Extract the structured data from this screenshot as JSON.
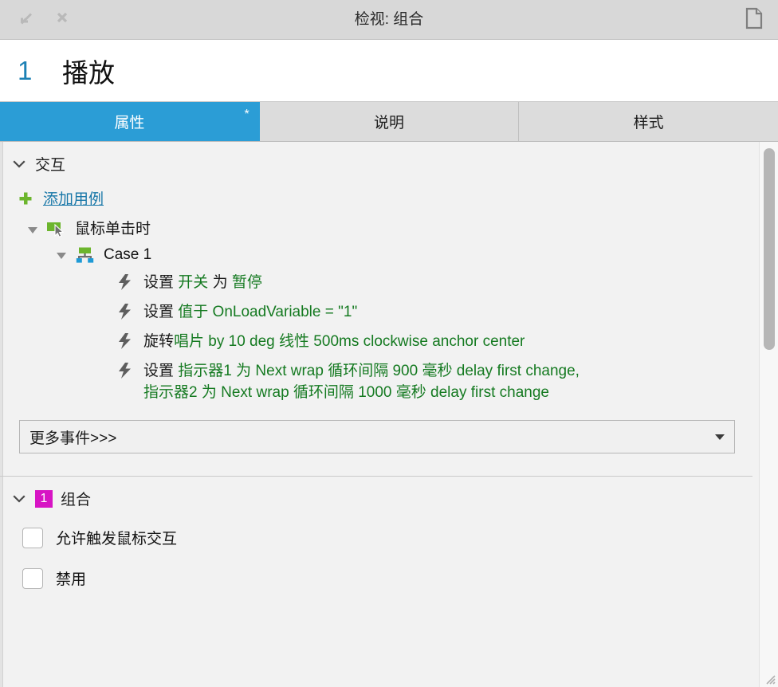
{
  "titlebar": {
    "title": "检视: 组合",
    "restore_icon": "minimize-restore-icon",
    "close_icon": "close-icon",
    "page_icon": "page-icon"
  },
  "object_header": {
    "number": "1",
    "name": "播放"
  },
  "tabs": [
    {
      "label": "属性",
      "active": true,
      "modified_marker": "*"
    },
    {
      "label": "说明",
      "active": false,
      "modified_marker": ""
    },
    {
      "label": "样式",
      "active": false,
      "modified_marker": ""
    }
  ],
  "interactions": {
    "section_title": "交互",
    "add_case_label": "添加用例",
    "event": {
      "label": "鼠标单击时",
      "icon": "mouse-click-icon"
    },
    "case": {
      "label": "Case 1",
      "icon": "case-branch-icon"
    },
    "actions": [
      {
        "icon": "lightning-bolt-icon",
        "lines": [
          [
            {
              "text": "设置 ",
              "kind": "verb"
            },
            {
              "text": "开关 ",
              "kind": "arg"
            },
            {
              "text": "为 ",
              "kind": "verb"
            },
            {
              "text": "暂停",
              "kind": "arg"
            }
          ]
        ]
      },
      {
        "icon": "lightning-bolt-icon",
        "lines": [
          [
            {
              "text": "设置 ",
              "kind": "verb"
            },
            {
              "text": "值于 OnLoadVariable = \"1\"",
              "kind": "arg"
            }
          ]
        ]
      },
      {
        "icon": "lightning-bolt-icon",
        "lines": [
          [
            {
              "text": "旋转",
              "kind": "verb"
            },
            {
              "text": "唱片 by 10 deg 线性 500ms clockwise anchor center",
              "kind": "arg"
            }
          ]
        ]
      },
      {
        "icon": "lightning-bolt-icon",
        "lines": [
          [
            {
              "text": "设置 ",
              "kind": "verb"
            },
            {
              "text": "指示器1 为 Next wrap 循环间隔 900 毫秒 delay first change,",
              "kind": "arg"
            }
          ],
          [
            {
              "text": "指示器2 为 Next wrap 循环间隔 1000 毫秒 delay first change",
              "kind": "arg"
            }
          ]
        ]
      }
    ],
    "more_events": {
      "label": "更多事件>>>",
      "arrow_icon": "chevron-down-icon"
    }
  },
  "group_section": {
    "badge": "1",
    "title": "组合",
    "checkboxes": [
      {
        "label": "允许触发鼠标交互",
        "checked": false
      },
      {
        "label": "禁用",
        "checked": false
      }
    ]
  },
  "colors": {
    "accent_blue": "#2b9dd6",
    "link_blue": "#1877a8",
    "header_number_blue": "#1d81b5",
    "action_green": "#157a21",
    "badge_magenta": "#d714c4",
    "icon_green": "#6cb52d",
    "icon_blue": "#1e9ad6",
    "titlebar_bg": "#d8d8d8",
    "panel_bg": "#f2f2f2"
  },
  "scrollbar": {
    "orientation": "vertical",
    "thumb_top_pct": 2,
    "thumb_height_pct": 39
  }
}
